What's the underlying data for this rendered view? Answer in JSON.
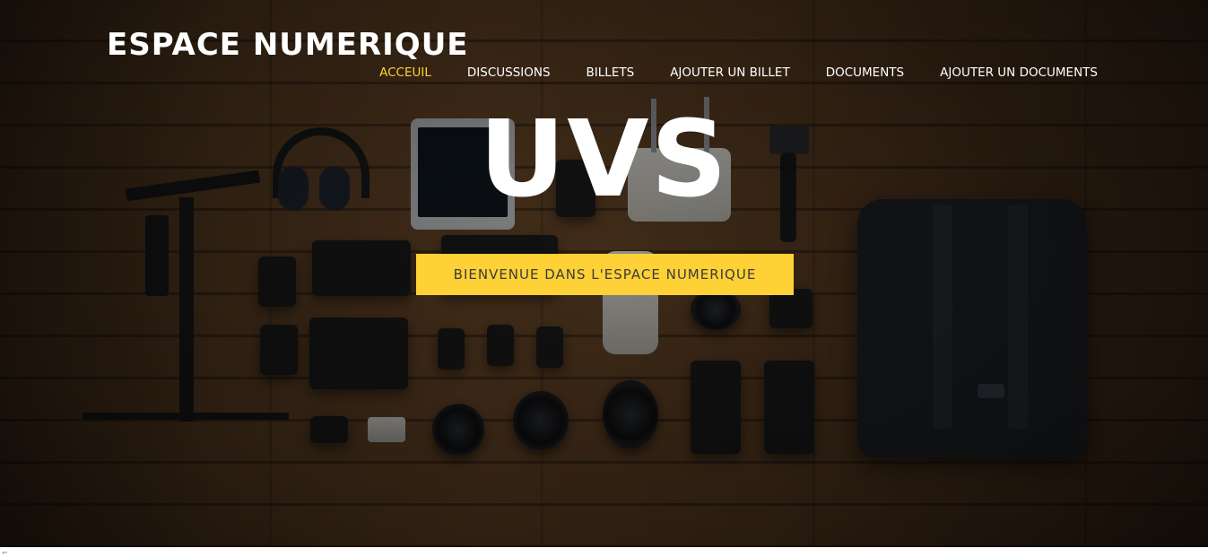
{
  "header": {
    "site_title": "ESPACE NUMERIQUE"
  },
  "nav": {
    "items": [
      {
        "label": "ACCEUIL",
        "active": true
      },
      {
        "label": "DISCUSSIONS",
        "active": false
      },
      {
        "label": "BILLETS",
        "active": false
      },
      {
        "label": "AJOUTER UN BILLET",
        "active": false
      },
      {
        "label": "DOCUMENTS",
        "active": false
      },
      {
        "label": "AJOUTER UN DOCUMENTS",
        "active": false
      }
    ]
  },
  "hero": {
    "heading": "UVS",
    "cta_label": "BIENVENUE DANS L'ESPACE NUMERIQUE",
    "background": "photo-camera-gear-on-wooden-floor"
  },
  "colors": {
    "accent": "#fed136",
    "text": "#ffffff",
    "cta_text": "#3b3b3b"
  }
}
